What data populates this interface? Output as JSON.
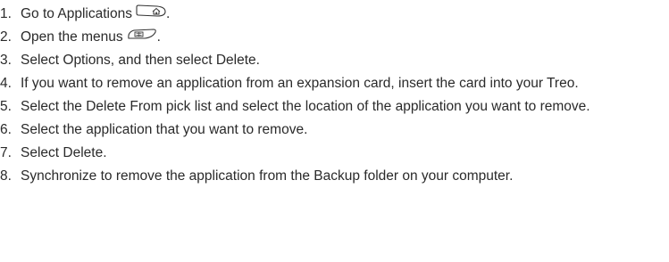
{
  "steps": [
    {
      "number": "1.",
      "text": "Go to Applications",
      "icon": "home-key-icon",
      "after": "."
    },
    {
      "number": "2.",
      "text": "Open the menus",
      "icon": "menu-key-icon",
      "after": "."
    },
    {
      "number": "3.",
      "text": "Select Options, and then select Delete."
    },
    {
      "number": "4.",
      "text": "If you want to remove an application from an expansion card, insert the card into your Treo."
    },
    {
      "number": "5.",
      "text": "Select the Delete From pick list and select the location of the application you want to remove."
    },
    {
      "number": "6.",
      "text": "Select the application that you want to remove."
    },
    {
      "number": "7.",
      "text": "Select Delete."
    },
    {
      "number": "8.",
      "text": "Synchronize to remove the application from the Backup folder on your computer."
    }
  ]
}
